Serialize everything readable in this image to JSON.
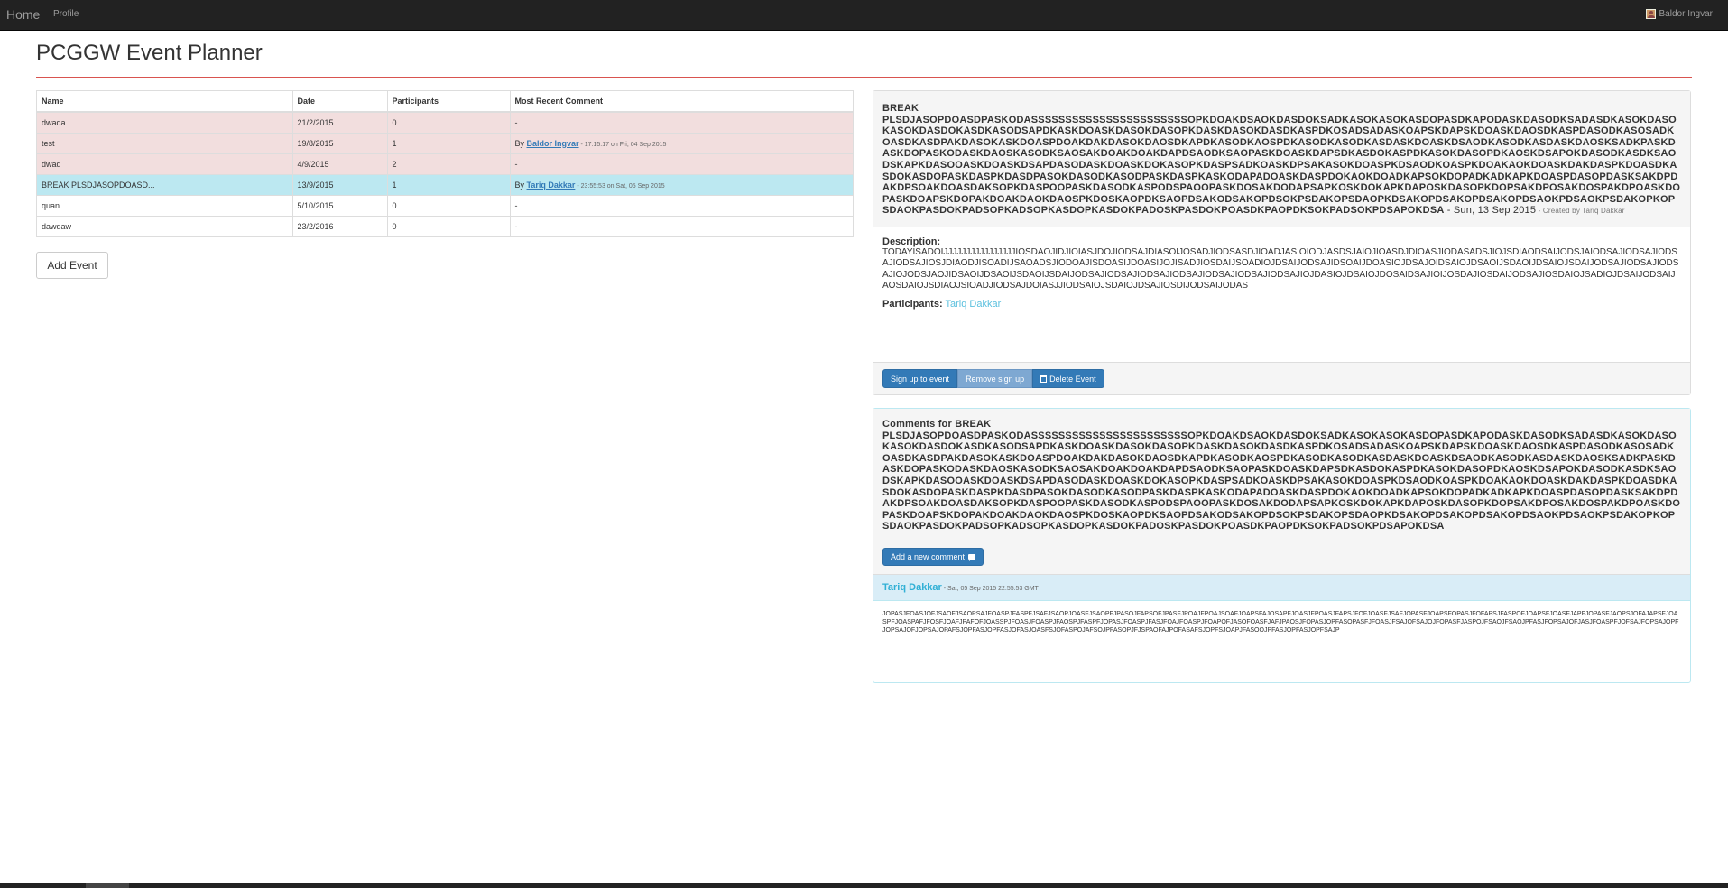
{
  "nav": {
    "home": "Home",
    "profile": "Profile",
    "user": "Baldor Ingvar"
  },
  "page": {
    "title": "PCGGW Event Planner"
  },
  "table": {
    "headers": [
      "Name",
      "Date",
      "Participants",
      "Most Recent Comment"
    ],
    "rows": [
      {
        "name": "dwada",
        "date": "21/2/2015",
        "participants": "0",
        "comment": "-"
      },
      {
        "name": "test",
        "date": "19/8/2015",
        "participants": "1",
        "comment_prefix": "By ",
        "comment_author": "Baldor Ingvar",
        "comment_meta": " - 17:15:17 on Fri, 04 Sep 2015"
      },
      {
        "name": "dwad",
        "date": "4/9/2015",
        "participants": "2",
        "comment": "-"
      },
      {
        "name": "BREAK PLSDJASOPDOASD...",
        "date": "13/9/2015",
        "participants": "1",
        "comment_prefix": "By ",
        "comment_author": "Tariq Dakkar",
        "comment_meta": " - 23:55:53 on Sat, 05 Sep 2015"
      },
      {
        "name": "quan",
        "date": "5/10/2015",
        "participants": "0",
        "comment": "-"
      },
      {
        "name": "dawdaw",
        "date": "23/2/2016",
        "participants": "0",
        "comment": "-"
      }
    ]
  },
  "buttons": {
    "add_event": "Add Event"
  },
  "detail": {
    "name_line1": "BREAK",
    "name_rest": "PLSDJASOPDOASDPASKODASSSSSSSSSSSSSSSSSSSSSSSOPKDOAKDSAOKDASDOKSADKASOKASOKASDOPASDKAPODASKDASODKSADASDKASOKDASOKASOKDASDOKASDKASODSAPDKASKDOASKDASOKDASOPKDASKDASOKDASDKASPDKOSADSADASKOAPSKDAPSKDOASKDAOSDKASPDASODKASOSADKOASDKASDPAKDASOKASKDOASPDOAKDAKDASOKDAOSDKAPDKASODKAOSPDKASODKASODKASDASKDOASKDSAODKASODKASDASKDAOSKSADKPASKDASKDOPASKODASKDAOSKASODKSAOSAKDOAKDOAKDAPDSAODKSAOPASKDOASKDAPSDKASDOKASPDKASOKDASOPDKAOSKDSAPOKDASODKASDKSAODSKAPKDASOOASKDOASKDSAPDASODASKDOASKDOKASOPKDASPSADKOASKDPSAKASOKDOASPKDSAODKOASPKDOAKAOKDOASKDAKDASPKDOASDKASDOKASDOPASKDASPKDASDPASOKDASODKASODPASKDASPKASKODAPADOASKDASPDOKAOKDOADKAPSOKDOPADKADKAPKDOASPDASOPDASKSAKDPDAKDPSOAKDOASDAKSOPKDASPOOPASKDASODKASPODSPAOOPASKDOSAKDODAPSAPKOSKDOKAPKDAPOSKDASOPKDOPSAKDPOSAKDOSPAKDPOASKDOPASKDOAPSKDOPAKDOAKDAOKDAOSPKDOSKAOPDKSAOPDSAKODSAKOPDSOKPSDAKOPSDAOPKDSAKOPDSAKOPDSAKOPDSAOKPDSAOKPSDAKOPKOPSDAOKPASDOKPADSOPKADSOPKASDOPKASDOKPADOSKPASDOKPOASDKPAOPDKSOKPADSOKPDSAPOKDSA",
    "date": " - Sun, 13 Sep 2015",
    "creator": " - Created by Tariq Dakkar",
    "description_label": "Description:",
    "description": "TODAYISADOIJJJJJJJJJJJJJJJJIOSDAOJIDJIOIASJDOJIODSAJDIASOIJOSADJIODSASDJIOADJASIOIODJASDSJAIOJIOASDJDIOASJIODASADSJIOJSDIAODSAIJODSJAIODSAJIODSAJIODSAJIODSAJIOSJDIAODJISOADIJSAOADSJIODOAJISDOASIJDOASIJOJISADJIOSDAIJSOADIOJDSAIJODSAJIDSOAIJDOASIOJDSAJOIDSAIOJDSAOIJSDAOIJDSAIOJSDAIJODSAJIODSAJIODSAJIOJODSJAOJIDSAOIJDSAOIJSDAOIJSDAIJODSAJIODSAJIODSAJIODSAJIODSAJIODSAJIODSAJIOJDASIOJDSAIOJDOSAIDSAJIOIJOSDAJIOSDAIJODSAJIOSDAIOJSADIOJDSAIJODSAIJAOSDAIOJSDIAOJSIOADJIODSAJDOIASJJIODSAIOJSDAIOJDSAJIOSDIJODSAIJODAS",
    "participants_label": "Participants:",
    "participant": "Tariq Dakkar",
    "sign_up": "Sign up to event",
    "remove_sign_up": "Remove sign up",
    "delete_event": "Delete Event"
  },
  "comments": {
    "title_prefix": "Comments for BREAK",
    "title_rest": "PLSDJASOPDOASDPASKODASSSSSSSSSSSSSSSSSSSSSSSOPKDOAKDSAOKDASDOKSADKASOKASOKASDOPASDKAPODASKDASODKSADASDKASOKDASOKASOKDASDOKASDKASODSAPDKASKDOASKDASOKDASOPKDASKDASOKDASDKASPDKOSADSADASKOAPSKDAPSKDOASKDAOSDKASPDASODKASOSADKOASDKASDPAKDASOKASKDOASPDOAKDAKDASOKDAOSDKAPDKASODKAOSPDKASODKASODKASDASKDOASKDSAODKASODKASDASKDAOSKSADKPASKDASKDOPASKODASKDAOSKASODKSAOSAKDOAKDOAKDAPDSAODKSAOPASKDOASKDAPSDKASDOKASPDKASOKDASOPDKAOSKDSAPOKDASODKASDKSAODSKAPKDASOOASKDOASKDSAPDASODASKDOASKDOKASOPKDASPSADKOASKDPSAKASOKDOASPKDSAODKOASPKDOAKAOKDOASKDAKDASPKDOASDKASDOKASDOPASKDASPKDASDPASOKDASODKASODPASKDASPKASKODAPADOASKDASPDOKAOKDOADKAPSOKDOPADKADKAPKDOASPDASOPDASKSAKDPDAKDPSOAKDOASDAKSOPKDASPOOPASKDASODKASPODSPAOOPASKDOSAKDODAPSAPKOSKDOKAPKDAPOSKDASOPKDOPSAKDPOSAKDOSPAKDPOASKDOPASKDOAPSKDOPAKDOAKDAOKDAOSPKDOSKAOPDKSAOPDSAKODSAKOPDSOKPSDAKOPSDAOPKDSAKOPDSAKOPDSAKOPDSAOKPDSAOKPSDAKOPKOPSDAOKPASDOKPADSOPKADSOPKASDOPKASDOKPADOSKPASDOKPOASDKPAOPDKSOKPADSOKPDSAPOKDSA",
    "add_comment": "Add a new comment",
    "items": [
      {
        "author": "Tariq Dakkar",
        "time": " - Sat, 05 Sep 2015 22:55:53 GMT",
        "body": "JOPASJFOASJOFJSAOFJSAOPSAJFOASPJFASPFJSAFJSAOPJOASFJSAOPFJPASOJFAPSOFJPASFJPOAJFPOAJSOAFJOAPSFAJOSAPFJOASJFPOASJFAPSJFOFJOASFJSAFJOPASFJOAPSFOPASJFOFAPSJFASPOFJOAPSFJOASFJAPFJOPASFJAOPSJOFAJAPSFJOASPFJOASPAFJFOSFJOAFJPAFOFJOASSPJFOASJFOASPJFAOSPJFASPFJOPASJFOASPJFASJFOAJFOASPJFOAPOFJASOFOASFJAFJPAOSJFOPASJOPFASOPASFJFOASJFSAJOFSAJOJFOPASFJASPOJFSAOJFSAOJPFASJFOPSAJOFJASJFOASPFJOFSAJFOPSAJOPFJOPSAJOFJOPSAJOPAFSJOPFASJOPFASJOFASJOASFSJOFASPOJAFSOJPFASOPJFJSPAOFAJPOFASAFSJOPFSJOAPJFASOOJPFASJOPFASJOPFSAJP"
      }
    ]
  }
}
